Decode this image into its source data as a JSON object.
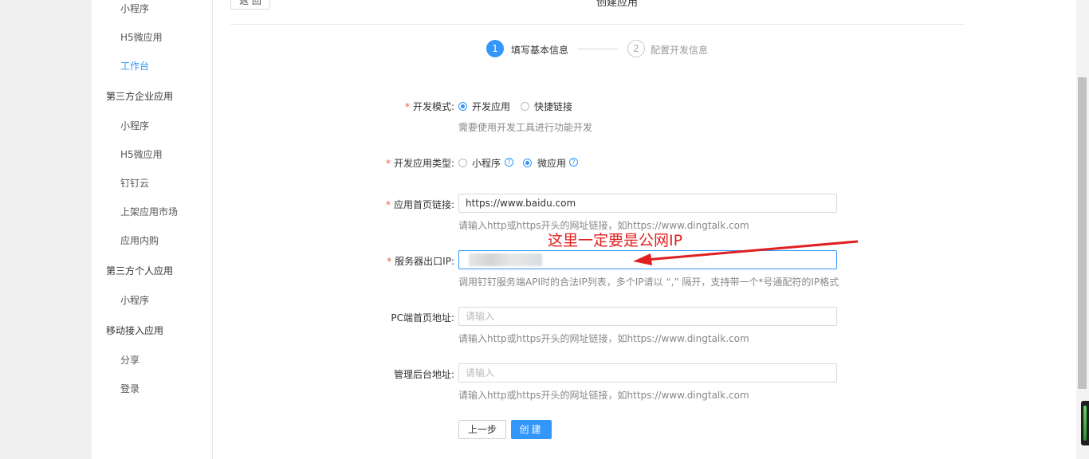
{
  "sidebar": {
    "items": [
      {
        "label": "小程序",
        "type": "sub"
      },
      {
        "label": "H5微应用",
        "type": "sub"
      },
      {
        "label": "工作台",
        "type": "sub",
        "active": true
      },
      {
        "label": "第三方企业应用",
        "type": "group"
      },
      {
        "label": "小程序",
        "type": "sub"
      },
      {
        "label": "H5微应用",
        "type": "sub"
      },
      {
        "label": "钉钉云",
        "type": "sub"
      },
      {
        "label": "上架应用市场",
        "type": "sub"
      },
      {
        "label": "应用内购",
        "type": "sub"
      },
      {
        "label": "第三方个人应用",
        "type": "group"
      },
      {
        "label": "小程序",
        "type": "sub"
      },
      {
        "label": "移动接入应用",
        "type": "group"
      },
      {
        "label": "分享",
        "type": "sub"
      },
      {
        "label": "登录",
        "type": "sub"
      }
    ]
  },
  "header": {
    "back_label": "返 回",
    "title": "创建应用"
  },
  "steps": [
    {
      "number": "1",
      "label": "填写基本信息"
    },
    {
      "number": "2",
      "label": "配置开发信息"
    }
  ],
  "form": {
    "dev_mode": {
      "label": "开发模式:",
      "options": [
        "开发应用",
        "快捷链接"
      ],
      "hint": "需要使用开发工具进行功能开发"
    },
    "app_type": {
      "label": "开发应用类型:",
      "options": [
        "小程序",
        "微应用"
      ],
      "help_glyph": "?"
    },
    "homepage": {
      "label": "应用首页链接:",
      "value": "https://www.baidu.com",
      "hint": "请输入http或https开头的网址链接，如https://www.dingtalk.com"
    },
    "server_ip": {
      "label": "服务器出口IP:",
      "hint": "调用钉钉服务端API时的合法IP列表，多个IP请以 “,” 隔开，支持带一个*号通配符的IP格式"
    },
    "pc_homepage": {
      "label": "PC端首页地址:",
      "placeholder": "请输入",
      "hint": "请输入http或https开头的网址链接，如https://www.dingtalk.com"
    },
    "admin_url": {
      "label": "管理后台地址:",
      "placeholder": "请输入",
      "hint": "请输入http或https开头的网址链接，如https://www.dingtalk.com"
    },
    "required_mark": "*"
  },
  "actions": {
    "prev_label": "上一步",
    "create_label": "创建"
  },
  "annotation": {
    "text": "这里一定要是公网IP",
    "color": "#e02020"
  },
  "colors": {
    "accent": "#3296fa",
    "required": "#f25643"
  }
}
